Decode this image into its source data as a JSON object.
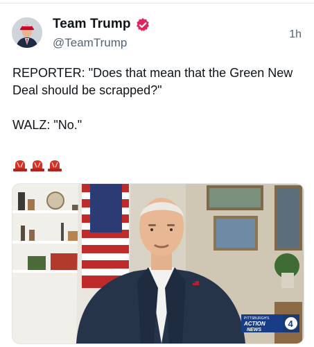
{
  "author": {
    "display_name": "Team Trump",
    "handle": "@TeamTrump",
    "avatar_icon": "profile-avatar",
    "verified_icon": "verified-badge-icon"
  },
  "post": {
    "timestamp": "1h",
    "paragraphs": [
      "REPORTER: \"Does that mean that the Green New Deal should be scrapped?\"",
      "WALZ: \"No.\""
    ],
    "emojis": [
      "police-siren-icon",
      "police-siren-icon",
      "police-siren-icon"
    ]
  },
  "media": {
    "type": "video-still",
    "logo_line1": "PITTSBURGH'S",
    "logo_line2": "ACTION",
    "logo_line3": "NEWS",
    "logo_number": "4"
  },
  "colors": {
    "verified_red": "#e0245e",
    "siren_red": "#d93025",
    "muted_text": "#536471"
  }
}
